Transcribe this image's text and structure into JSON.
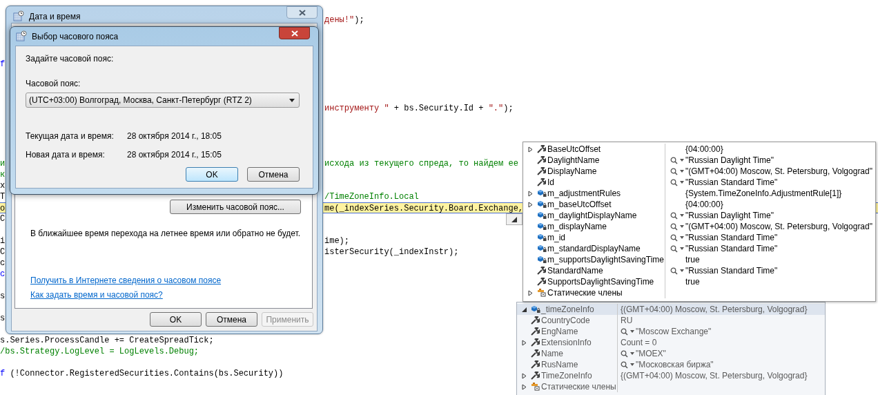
{
  "code_lines": [
    {
      "current": false,
      "right": [
        {
          "text": "дены!\"",
          "kind": "string"
        },
        {
          "text": ");",
          "kind": "plain"
        }
      ]
    },
    {
      "current": false,
      "left": [
        {
          "text": "f",
          "kind": "keyword"
        }
      ]
    },
    {
      "current": false,
      "right": [
        {
          "text": "инструменту \"",
          "kind": "string"
        },
        {
          "text": " + bs.Security.Id + ",
          "kind": "plain"
        },
        {
          "text": "\".\"",
          "kind": "string"
        },
        {
          "text": ");",
          "kind": "plain"
        }
      ]
    },
    {
      "current": false,
      "left": [
        {
          "text": "и",
          "kind": "comment"
        }
      ],
      "right": [
        {
          "text": "исхода из текущего спреда, то найдем ее",
          "kind": "comment"
        }
      ]
    },
    {
      "current": false,
      "left": [
        {
          "text": "к",
          "kind": "comment"
        }
      ]
    },
    {
      "current": false,
      "left": [
        {
          "text": "х",
          "kind": "plain"
        }
      ]
    },
    {
      "current": false,
      "left": [
        {
          "text": "T",
          "kind": "plain"
        }
      ],
      "right": [
        {
          "text": "/TimeZoneInfo.Local",
          "kind": "comment"
        }
      ]
    },
    {
      "current": true,
      "left": [
        {
          "text": "o",
          "kind": "plain"
        }
      ],
      "right": [
        {
          "text": "me(_indexSeries.Security.Board.Exchange,",
          "kind": "plain"
        }
      ]
    },
    {
      "current": false,
      "left": [
        {
          "text": "C",
          "kind": "plain"
        }
      ]
    },
    {
      "current": false,
      "left": [
        {
          "text": "i",
          "kind": "plain"
        }
      ],
      "right": [
        {
          "text": "ime);",
          "kind": "plain"
        }
      ]
    },
    {
      "current": false,
      "left": [
        {
          "text": "C",
          "kind": "plain"
        }
      ],
      "right": [
        {
          "text": "isterSecurity(_indexInstr);",
          "kind": "plain"
        }
      ]
    },
    {
      "current": false,
      "left": [
        {
          "text": "c",
          "kind": "plain"
        }
      ]
    },
    {
      "current": false,
      "left": [
        {
          "text": "c",
          "kind": "keyword"
        }
      ]
    },
    {
      "current": false,
      "left": [
        {
          "text": "s",
          "kind": "plain"
        }
      ]
    },
    {
      "current": false,
      "left": [
        {
          "text": "s",
          "kind": "plain"
        }
      ]
    },
    {
      "current": false,
      "left": [
        {
          "text": "s.Series.ProcessCandle += CreateSpreadTick;",
          "kind": "plain"
        }
      ]
    },
    {
      "current": false,
      "left": [
        {
          "text": "/bs.Strategy.LogLevel = LogLevels.Debug;",
          "kind": "comment"
        }
      ]
    },
    {
      "current": false,
      "left": [
        {
          "text": "f",
          "kind": "keyword"
        },
        {
          "text": " (!Connector.RegisteredSecurities.Contains(bs.Security))",
          "kind": "plain"
        }
      ]
    }
  ],
  "date_time_window": {
    "title": "Дата и время",
    "change_timezone_button": "Изменить часовой пояс...",
    "dst_notice": "В ближайшее время перехода на летнее время или обратно не будет.",
    "links": [
      "Получить в Интернете сведения о часовом поясе",
      "Как задать время и часовой пояс?"
    ],
    "buttons": [
      {
        "label": "OK",
        "disabled": false
      },
      {
        "label": "Отмена",
        "disabled": false
      },
      {
        "label": "Применить",
        "disabled": true
      }
    ]
  },
  "timezone_dialog": {
    "title": "Выбор часового пояса",
    "prompt": "Задайте часовой пояс:",
    "timezone_label": "Часовой пояс:",
    "timezone_value": "(UTC+03:00) Волгоград, Москва, Санкт-Петербург (RTZ 2)",
    "rows": [
      {
        "label": "Текущая дата и время:",
        "value": "28 октября 2014 г., 18:05"
      },
      {
        "label": "Новая дата и время:",
        "value": "28 октября 2014 г., 15:05"
      }
    ],
    "buttons": [
      {
        "label": "OK",
        "default": true
      },
      {
        "label": "Отмена",
        "default": false
      }
    ]
  },
  "datatip": {
    "rows": [
      {
        "name": "BaseUtcOffset",
        "kind": "property",
        "expanded": false,
        "value": "{04:00:00}",
        "visualizer": false
      },
      {
        "name": "DaylightName",
        "kind": "property",
        "value": "\"Russian Daylight Time\"",
        "visualizer": true
      },
      {
        "name": "DisplayName",
        "kind": "property",
        "value": "\"(GMT+04:00) Moscow, St. Petersburg, Volgograd\"",
        "visualizer": true
      },
      {
        "name": "Id",
        "kind": "property",
        "value": "\"Russian Standard Time\"",
        "visualizer": true
      },
      {
        "name": "m_adjustmentRules",
        "kind": "private_field",
        "expanded": false,
        "value": "{System.TimeZoneInfo.AdjustmentRule[1]}",
        "visualizer": false
      },
      {
        "name": "m_baseUtcOffset",
        "kind": "private_field",
        "expanded": false,
        "value": "{04:00:00}",
        "visualizer": false
      },
      {
        "name": "m_daylightDisplayName",
        "kind": "private_field",
        "value": "\"Russian Daylight Time\"",
        "visualizer": true
      },
      {
        "name": "m_displayName",
        "kind": "private_field",
        "value": "\"(GMT+04:00) Moscow, St. Petersburg, Volgograd\"",
        "visualizer": true
      },
      {
        "name": "m_id",
        "kind": "private_field",
        "value": "\"Russian Standard Time\"",
        "visualizer": true
      },
      {
        "name": "m_standardDisplayName",
        "kind": "private_field",
        "value": "\"Russian Standard Time\"",
        "visualizer": true
      },
      {
        "name": "m_supportsDaylightSavingTime",
        "kind": "private_field",
        "value": "true",
        "visualizer": false
      },
      {
        "name": "StandardName",
        "kind": "property",
        "value": "\"Russian Standard Time\"",
        "visualizer": true
      },
      {
        "name": "SupportsDaylightSavingTime",
        "kind": "property",
        "value": "true",
        "visualizer": false
      },
      {
        "name": "Статические члены",
        "kind": "static",
        "expanded": false,
        "visualizer": false
      }
    ]
  },
  "parent_datatip": {
    "rows": [
      {
        "name": "_timeZoneInfo",
        "kind": "private_field",
        "expanded": true,
        "value": "{(GMT+04:00) Moscow, St. Petersburg, Volgograd}",
        "visualizer": false,
        "selected": true
      },
      {
        "name": "CountryCode",
        "kind": "property",
        "value": "RU",
        "visualizer": false,
        "selected": false
      },
      {
        "name": "EngName",
        "kind": "property",
        "value": "\"Moscow Exchange\"",
        "visualizer": true,
        "selected": false
      },
      {
        "name": "ExtensionInfo",
        "kind": "property",
        "expanded": false,
        "value": "Count = 0",
        "visualizer": false,
        "selected": false
      },
      {
        "name": "Name",
        "kind": "property",
        "value": "\"MOEX\"",
        "visualizer": true,
        "selected": false
      },
      {
        "name": "RusName",
        "kind": "property",
        "value": "\"Московская биржа\"",
        "visualizer": true,
        "selected": false
      },
      {
        "name": "TimeZoneInfo",
        "kind": "property",
        "expanded": false,
        "value": "{(GMT+04:00) Moscow, St. Petersburg, Volgograd}",
        "visualizer": false,
        "selected": false
      },
      {
        "name": "Статические члены",
        "kind": "static",
        "expanded": false,
        "visualizer": false,
        "selected": false
      }
    ]
  }
}
